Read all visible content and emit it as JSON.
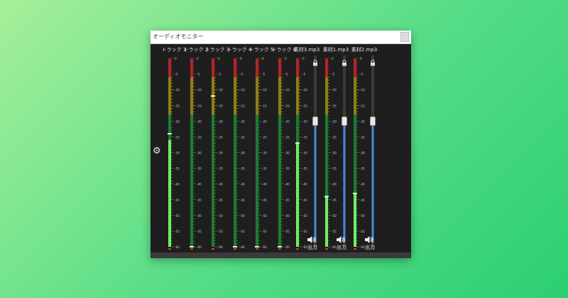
{
  "window": {
    "title": "オーディオモニター"
  },
  "meter": {
    "scale_labels": [
      "0",
      "-5",
      "-10",
      "-15",
      "-20",
      "-25",
      "-30",
      "-35",
      "-40",
      "-45",
      "-50",
      "-55",
      "-60"
    ],
    "scale_db_min": -60,
    "scale_db_max": 0,
    "colors": {
      "red": "#b0262a",
      "yellow": "#d8c21c",
      "green": "#2bb24a",
      "bright_green": "#6ff061",
      "fader_blue": "#3a86d8",
      "background": "#1e1e1e"
    }
  },
  "tracks": [
    {
      "label": "トラック 1",
      "level_db": -26,
      "peak_db": -24
    },
    {
      "label": "トラック 2",
      "level_db": -60,
      "peak_db": -60
    },
    {
      "label": "トラック 3",
      "level_db": -60,
      "peak_db": -12
    },
    {
      "label": "トラック 4",
      "level_db": -60,
      "peak_db": -60
    },
    {
      "label": "トラック 5",
      "level_db": -60,
      "peak_db": -60
    },
    {
      "label": "トラック 6",
      "level_db": -60,
      "peak_db": -60
    }
  ],
  "materials": [
    {
      "label": "素材3.mp3",
      "level_db": -27,
      "peak_db": -27,
      "fader_db": -20,
      "output_label": "出力"
    },
    {
      "label": "素材1.mp3",
      "level_db": -44,
      "peak_db": -44,
      "fader_db": -20,
      "output_label": "出力"
    },
    {
      "label": "素材2.mp3",
      "level_db": -43,
      "peak_db": -43,
      "fader_db": -20,
      "output_label": "出力"
    }
  ],
  "icons": {
    "settings": "gear-icon",
    "lock": "lock-icon",
    "speaker": "speaker-icon"
  }
}
